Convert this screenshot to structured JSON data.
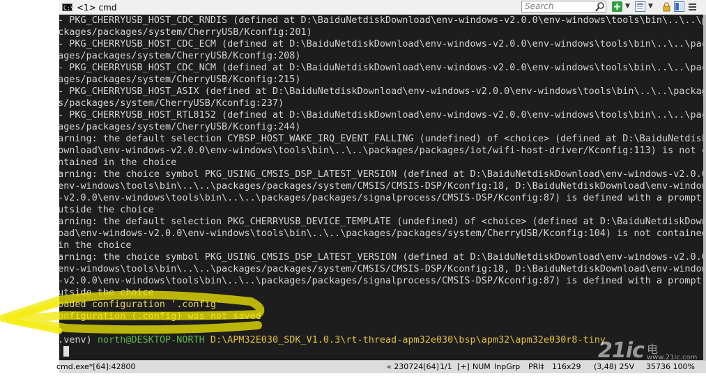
{
  "titlebar": {
    "tab_label": "<1> cmd",
    "icon": "cmd-console-icon",
    "search_placeholder": "Search"
  },
  "terminal": {
    "lines": [
      " - PKG_CHERRYUSB_HOST_CDC_RNDIS (defined at D:\\BaiduNetdiskDownload\\env-windows-v2.0.0\\env-windows\\tools\\bin\\..\\..\\pa",
      "ackages/packages/system/CherryUSB/Kconfig:201)",
      " - PKG_CHERRYUSB_HOST_CDC_ECM (defined at D:\\BaiduNetdiskDownload\\env-windows-v2.0.0\\env-windows\\tools\\bin\\..\\..\\pac",
      "kages/packages/system/CherryUSB/Kconfig:208)",
      " - PKG_CHERRYUSB_HOST_CDC_NCM (defined at D:\\BaiduNetdiskDownload\\env-windows-v2.0.0\\env-windows\\tools\\bin\\..\\..\\pac",
      "kages/packages/system/CherryUSB/Kconfig:215)",
      " - PKG_CHERRYUSB_HOST_ASIX (defined at D:\\BaiduNetdiskDownload\\env-windows-v2.0.0\\env-windows\\tools\\bin\\..\\..\\packag",
      "es/packages/system/CherryUSB/Kconfig:237)",
      " - PKG_CHERRYUSB_HOST_RTL8152 (defined at D:\\BaiduNetdiskDownload\\env-windows-v2.0.0\\env-windows\\tools\\bin\\..\\..\\pac",
      "kages/packages/system/CherryUSB/Kconfig:244)",
      "warning: the default selection CYBSP_HOST_WAKE_IRQ_EVENT_FALLING (undefined) of <choice> (defined at D:\\BaiduNetdisk",
      "Download\\env-windows-v2.0.0\\env-windows\\tools\\bin\\..\\..\\packages/packages/iot/wifi-host-driver/Kconfig:113) is not c",
      "ontained in the choice",
      "warning: the choice symbol PKG_USING_CMSIS_DSP_LATEST_VERSION (defined at D:\\BaiduNetdiskDownload\\env-windows-v2.0.0",
      "\\env-windows\\tools\\bin\\..\\..\\packages/packages/system/CMSIS/CMSIS-DSP/Kconfig:18, D:\\BaiduNetdiskDownload\\env-window",
      "s-v2.0.0\\env-windows\\tools\\bin\\..\\..\\packages/packages/signalprocess/CMSIS-DSP/Kconfig:87) is defined with a prompt",
      "outside the choice",
      "warning: the default selection PKG_CHERRYUSB_DEVICE_TEMPLATE (undefined) of <choice> (defined at D:\\BaiduNetdiskDown",
      "load\\env-windows-v2.0.0\\env-windows\\tools\\bin\\..\\..\\packages/packages/system/CherryUSB/Kconfig:104) is not contained",
      " in the choice",
      "warning: the choice symbol PKG_USING_CMSIS_DSP_LATEST_VERSION (defined at D:\\BaiduNetdiskDownload\\env-windows-v2.0.0",
      "\\env-windows\\tools\\bin\\..\\..\\packages/packages/system/CMSIS/CMSIS-DSP/Kconfig:18, D:\\BaiduNetdiskDownload\\env-window",
      "s-v2.0.0\\env-windows\\tools\\bin\\..\\..\\packages/packages/signalprocess/CMSIS-DSP/Kconfig:87) is defined with a prompt",
      "outside the choice",
      "Loaded configuration '.config'",
      "Configuration (.config) was not saved",
      ""
    ],
    "prompt": {
      "venv": "(.venv) ",
      "user_host": "north@DESKTOP-NORTH ",
      "path": "D:\\APM32E030_SDK_V1.0.3\\rt-thread-apm32e030\\bsp\\apm32\\apm32e030r8-tiny",
      "symbol": "$ "
    }
  },
  "statusbar": {
    "process": "cmd.exe*[64]:42800",
    "build": "« 230724[64]",
    "pages": "1/1",
    "mode": "[+]",
    "num": "NUM",
    "inpgrp": "InpGrp",
    "pri": "PRI‡",
    "size": "116x29",
    "cursor_pos": "(3,48) 25V",
    "pid_zoom": "35736 100%"
  },
  "watermark": {
    "logo": "21ic",
    "cn": "电子网",
    "url": "www.21ic.com"
  }
}
